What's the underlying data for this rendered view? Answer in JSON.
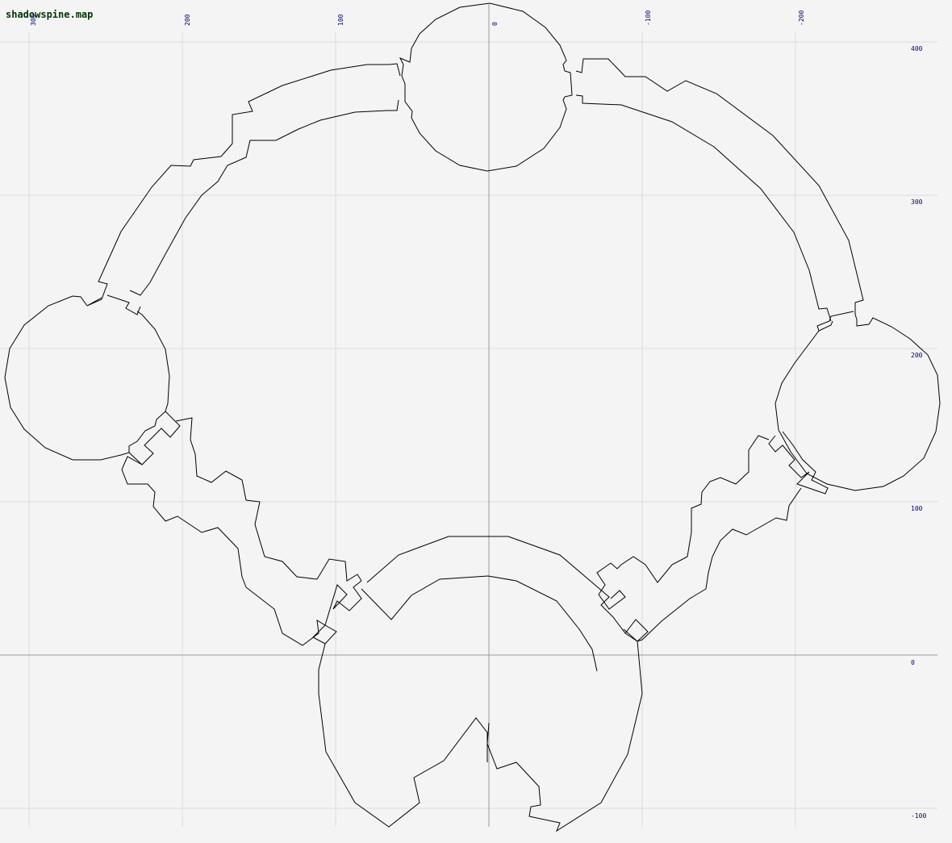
{
  "map": {
    "filename": "shadowspine.map",
    "x_ticks": [
      "300",
      "200",
      "100",
      "0",
      "-100",
      "-200"
    ],
    "y_ticks": [
      "400",
      "300",
      "200",
      "100",
      "0",
      "-100"
    ]
  },
  "colors": {
    "background": "#f4f4f4",
    "grid": "#dcdcdc",
    "axis": "#9a9a9a",
    "wall": "#000000",
    "tick_label": "#00007a",
    "title": "#003300"
  },
  "chart_data": {
    "type": "map",
    "x_axis_direction": "decreasing to the right",
    "xlim": [
      320,
      -290
    ],
    "ylim": [
      -110,
      415
    ],
    "grid_step": 100
  }
}
